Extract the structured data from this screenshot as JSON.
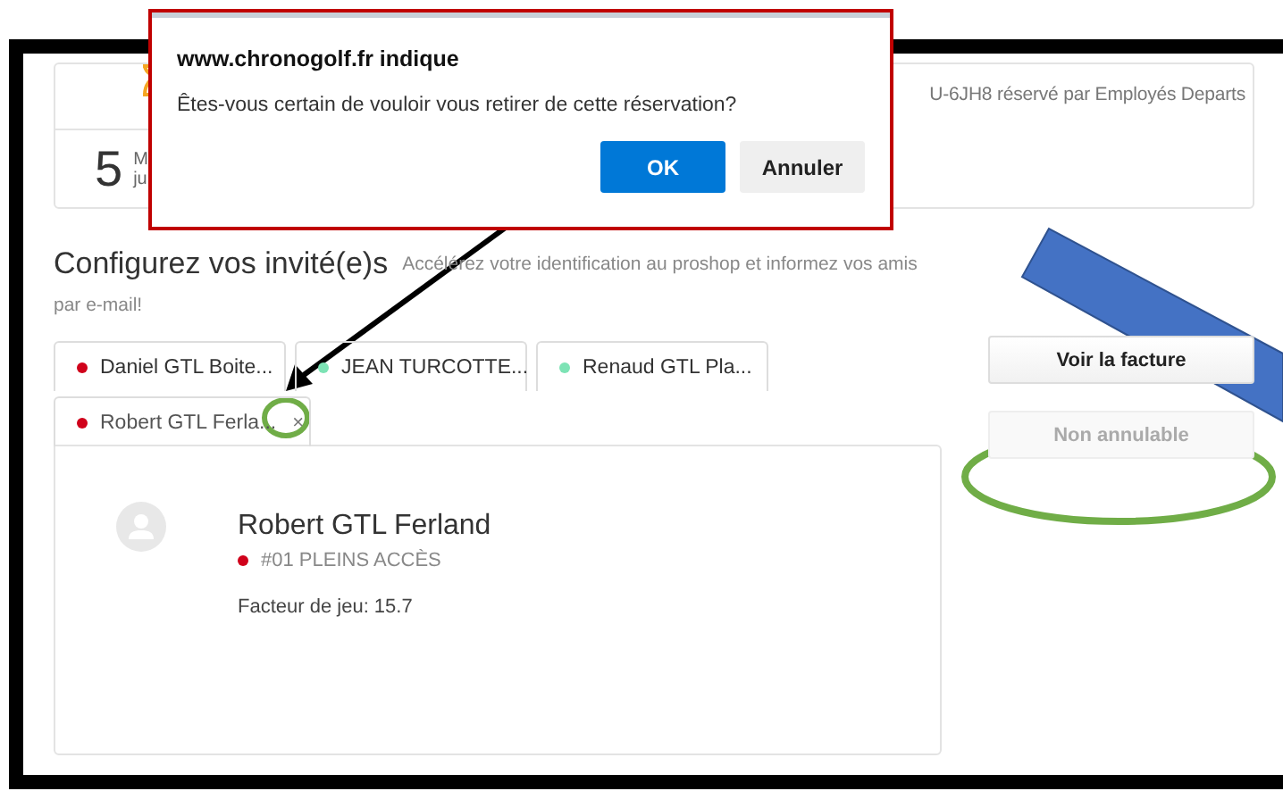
{
  "summary": {
    "count": "5",
    "fragments": [
      "M",
      "ju"
    ],
    "booking_text": "U-6JH8 réservé par Employés Departs"
  },
  "guests": {
    "heading": "Configurez vos invité(e)s",
    "hint": [
      "Accélérez votre identification au proshop et informez vos amis",
      "par e-mail!"
    ]
  },
  "tabs": [
    {
      "label": "Daniel GTL Boite...",
      "color": "#d0021b",
      "selected": false
    },
    {
      "label": "JEAN TURCOTTE...",
      "color": "#7de3b5",
      "selected": false
    },
    {
      "label": "Renaud GTL Pla...",
      "color": "#7de3b5",
      "selected": false
    },
    {
      "label": "Robert GTL Ferla...",
      "color": "#d0021b",
      "selected": true,
      "close": "×"
    }
  ],
  "player": {
    "name": "Robert GTL Ferland",
    "membership": {
      "label": "#01 PLEINS ACCÈS",
      "color": "#d0021b"
    },
    "factor": "Facteur de jeu: 15.7"
  },
  "actions": [
    {
      "label": "Voir la facture",
      "disabled": false
    },
    {
      "label": "Non annulable",
      "disabled": true
    }
  ],
  "dialog": {
    "title": "www.chronogolf.fr indique",
    "message": "Êtes-vous certain de vouloir vous retirer de cette réservation?",
    "buttons": [
      {
        "label": "OK",
        "kind": "primary"
      },
      {
        "label": "Annuler",
        "kind": "secondary"
      }
    ]
  }
}
